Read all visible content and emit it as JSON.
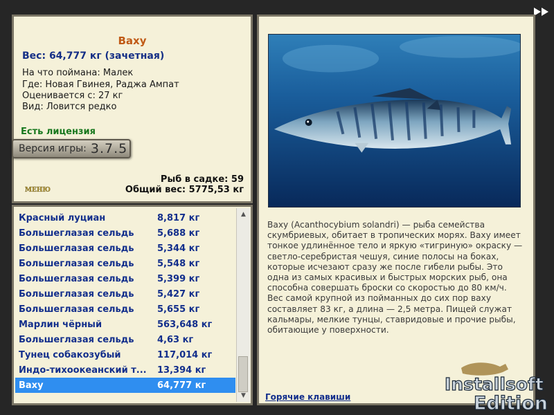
{
  "fish": {
    "title": "Ваху",
    "weight_line": "Вес: 64,777 кг (зачетная)",
    "caught_on": "На что поймана: Малек",
    "location": "Где: Новая Гвинея, Раджа Ампат",
    "value": "Оценивается с: 27 кг",
    "rarity": "Вид: Ловится редко",
    "license": "Есть лицензия"
  },
  "version": {
    "label": "Версия игры:",
    "number": "3.7.5"
  },
  "logo_text": "МЕНЮ",
  "stats": {
    "fish_count": "Рыб в садке: 59",
    "total_weight": "Общий вес: 5775,53 кг"
  },
  "catch_list": [
    {
      "name": "Красный луциан",
      "weight": "8,817 кг"
    },
    {
      "name": "Большеглазая сельдь",
      "weight": "5,688 кг"
    },
    {
      "name": "Большеглазая сельдь",
      "weight": "5,344 кг"
    },
    {
      "name": "Большеглазая сельдь",
      "weight": "5,548 кг"
    },
    {
      "name": "Большеглазая сельдь",
      "weight": "5,399 кг"
    },
    {
      "name": "Большеглазая сельдь",
      "weight": "5,427 кг"
    },
    {
      "name": "Большеглазая сельдь",
      "weight": "5,655 кг"
    },
    {
      "name": "Марлин чёрный",
      "weight": "563,648 кг"
    },
    {
      "name": "Большеглазая сельдь",
      "weight": "4,63 кг"
    },
    {
      "name": "Тунец собакозубый",
      "weight": "117,014 кг"
    },
    {
      "name": "Индо-тихоокеанский т...",
      "weight": "13,394 кг"
    },
    {
      "name": "Ваху",
      "weight": "64,777 кг"
    }
  ],
  "selected_index": 11,
  "description": "Ваху (Acanthocybium solandri) — рыба семейства скумбриевых, обитает в тропических морях. Ваху имеет тонкое удлинённое тело и яркую «тигриную» окраску — светло-серебристая чешуя, синие полосы на боках, которые исчезают сразу же после гибели рыбы. Это одна из самых красивых и быстрых морских рыб, она способна совершать броски со скоростью до 80 км/ч. Вес самой крупной из пойманных до сих пор ваху составляет 83 кг, а длина — 2,5 метра. Пищей служат кальмары, мелкие тунцы, ставридовые и прочие рыбы, обитающие у поверхности.",
  "hotkeys_link": "Горячие клавиши",
  "watermark": {
    "line1": "Installsoft",
    "line2": "Edition"
  },
  "colors": {
    "panel_bg": "#f5f1d9",
    "list_text": "#132f8c",
    "selected_bg": "#2f8ef0",
    "title": "#c05a16",
    "license": "#18781e"
  }
}
